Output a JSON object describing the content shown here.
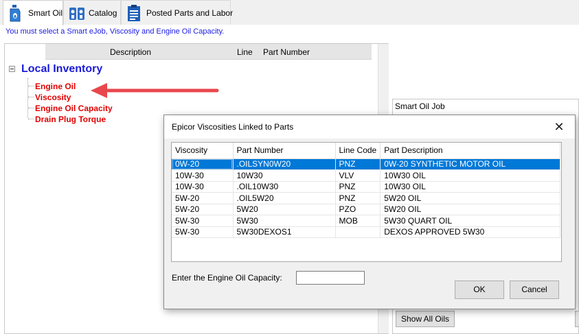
{
  "tabs": [
    {
      "label": "Smart Oil",
      "icon": "oil-bottle-icon",
      "active": true
    },
    {
      "label": "Catalog",
      "icon": "catalog-icon",
      "active": false
    },
    {
      "label": "Posted Parts and Labor",
      "icon": "clipboard-icon",
      "active": false
    }
  ],
  "instruction": "You must select a Smart eJob, Viscosity and Engine Oil Capacity.",
  "tree": {
    "columns": [
      "Description",
      "Line",
      "Part Number"
    ],
    "root": "Local Inventory",
    "items": [
      "Engine Oil",
      "Viscosity",
      "Engine Oil Capacity",
      "Drain Plug Torque"
    ]
  },
  "right_panel": {
    "title": "Smart Oil Job",
    "show_all_label": "Show All Oils"
  },
  "dialog": {
    "title": "Epicor Viscosities Linked to Parts",
    "close_glyph": "✕",
    "columns": [
      "Viscosity",
      "Part Number",
      "Line Code",
      "Part Description"
    ],
    "rows": [
      [
        "0W-20",
        ".OILSYN0W20",
        "PNZ",
        "0W-20 SYNTHETIC MOTOR OIL"
      ],
      [
        "10W-30",
        "10W30",
        "VLV",
        "10W30 OIL"
      ],
      [
        "10W-30",
        ".OIL10W30",
        "PNZ",
        "10W30 OIL"
      ],
      [
        "5W-20",
        ".OIL5W20",
        "PNZ",
        "5W20 OIL"
      ],
      [
        "5W-20",
        "5W20",
        "PZO",
        "5W20 OIL"
      ],
      [
        "5W-30",
        "5W30",
        "MOB",
        "5W30 QUART OIL"
      ],
      [
        "5W-30",
        "5W30DEXOS1",
        "",
        "DEXOS APPROVED 5W30"
      ]
    ],
    "capacity_label": "Enter the Engine Oil Capacity:",
    "capacity_value": "",
    "ok_label": "OK",
    "cancel_label": "Cancel"
  },
  "colors": {
    "accent_blue": "#1a1adc",
    "tree_item_red": "#e00000",
    "selection": "#0078d7",
    "arrow_red": "#e8474b"
  }
}
